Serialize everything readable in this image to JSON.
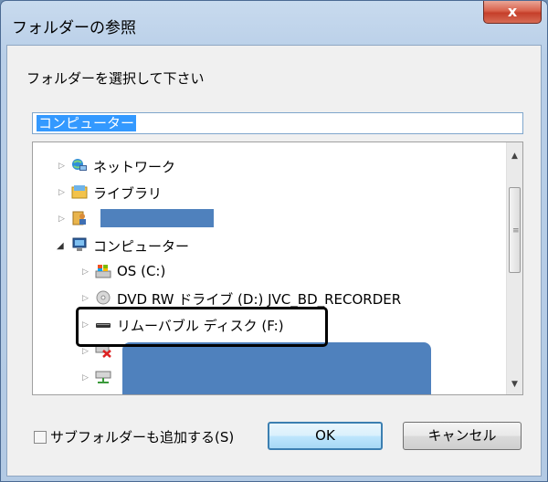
{
  "window": {
    "title": "フォルダーの参照",
    "close_label": "x"
  },
  "instruction": "フォルダーを選択して下さい",
  "path_field": {
    "value": "コンピューター"
  },
  "tree": {
    "items": [
      {
        "label": "ネットワーク",
        "icon": "network-icon"
      },
      {
        "label": "ライブラリ",
        "icon": "library-icon"
      },
      {
        "label": "",
        "icon": "user-folder-icon"
      },
      {
        "label": "コンピューター",
        "icon": "computer-icon"
      },
      {
        "label": "OS (C:)",
        "icon": "windows-drive-icon"
      },
      {
        "label": "DVD RW ドライブ (D:) JVC_BD_RECORDER",
        "icon": "dvd-drive-icon"
      },
      {
        "label": "リムーバブル ディスク (F:)",
        "icon": "removable-disk-icon"
      },
      {
        "label": "",
        "icon": "disconnected-network-drive-icon"
      },
      {
        "label": "",
        "icon": "network-drive-icon"
      }
    ]
  },
  "checkbox": {
    "label": "サブフォルダーも追加する(S)",
    "checked": false
  },
  "buttons": {
    "ok": "OK",
    "cancel": "キャンセル"
  },
  "colors": {
    "selection": "#3399ff",
    "redaction": "#4f81bd",
    "ok_border": "#3c7fb1"
  }
}
